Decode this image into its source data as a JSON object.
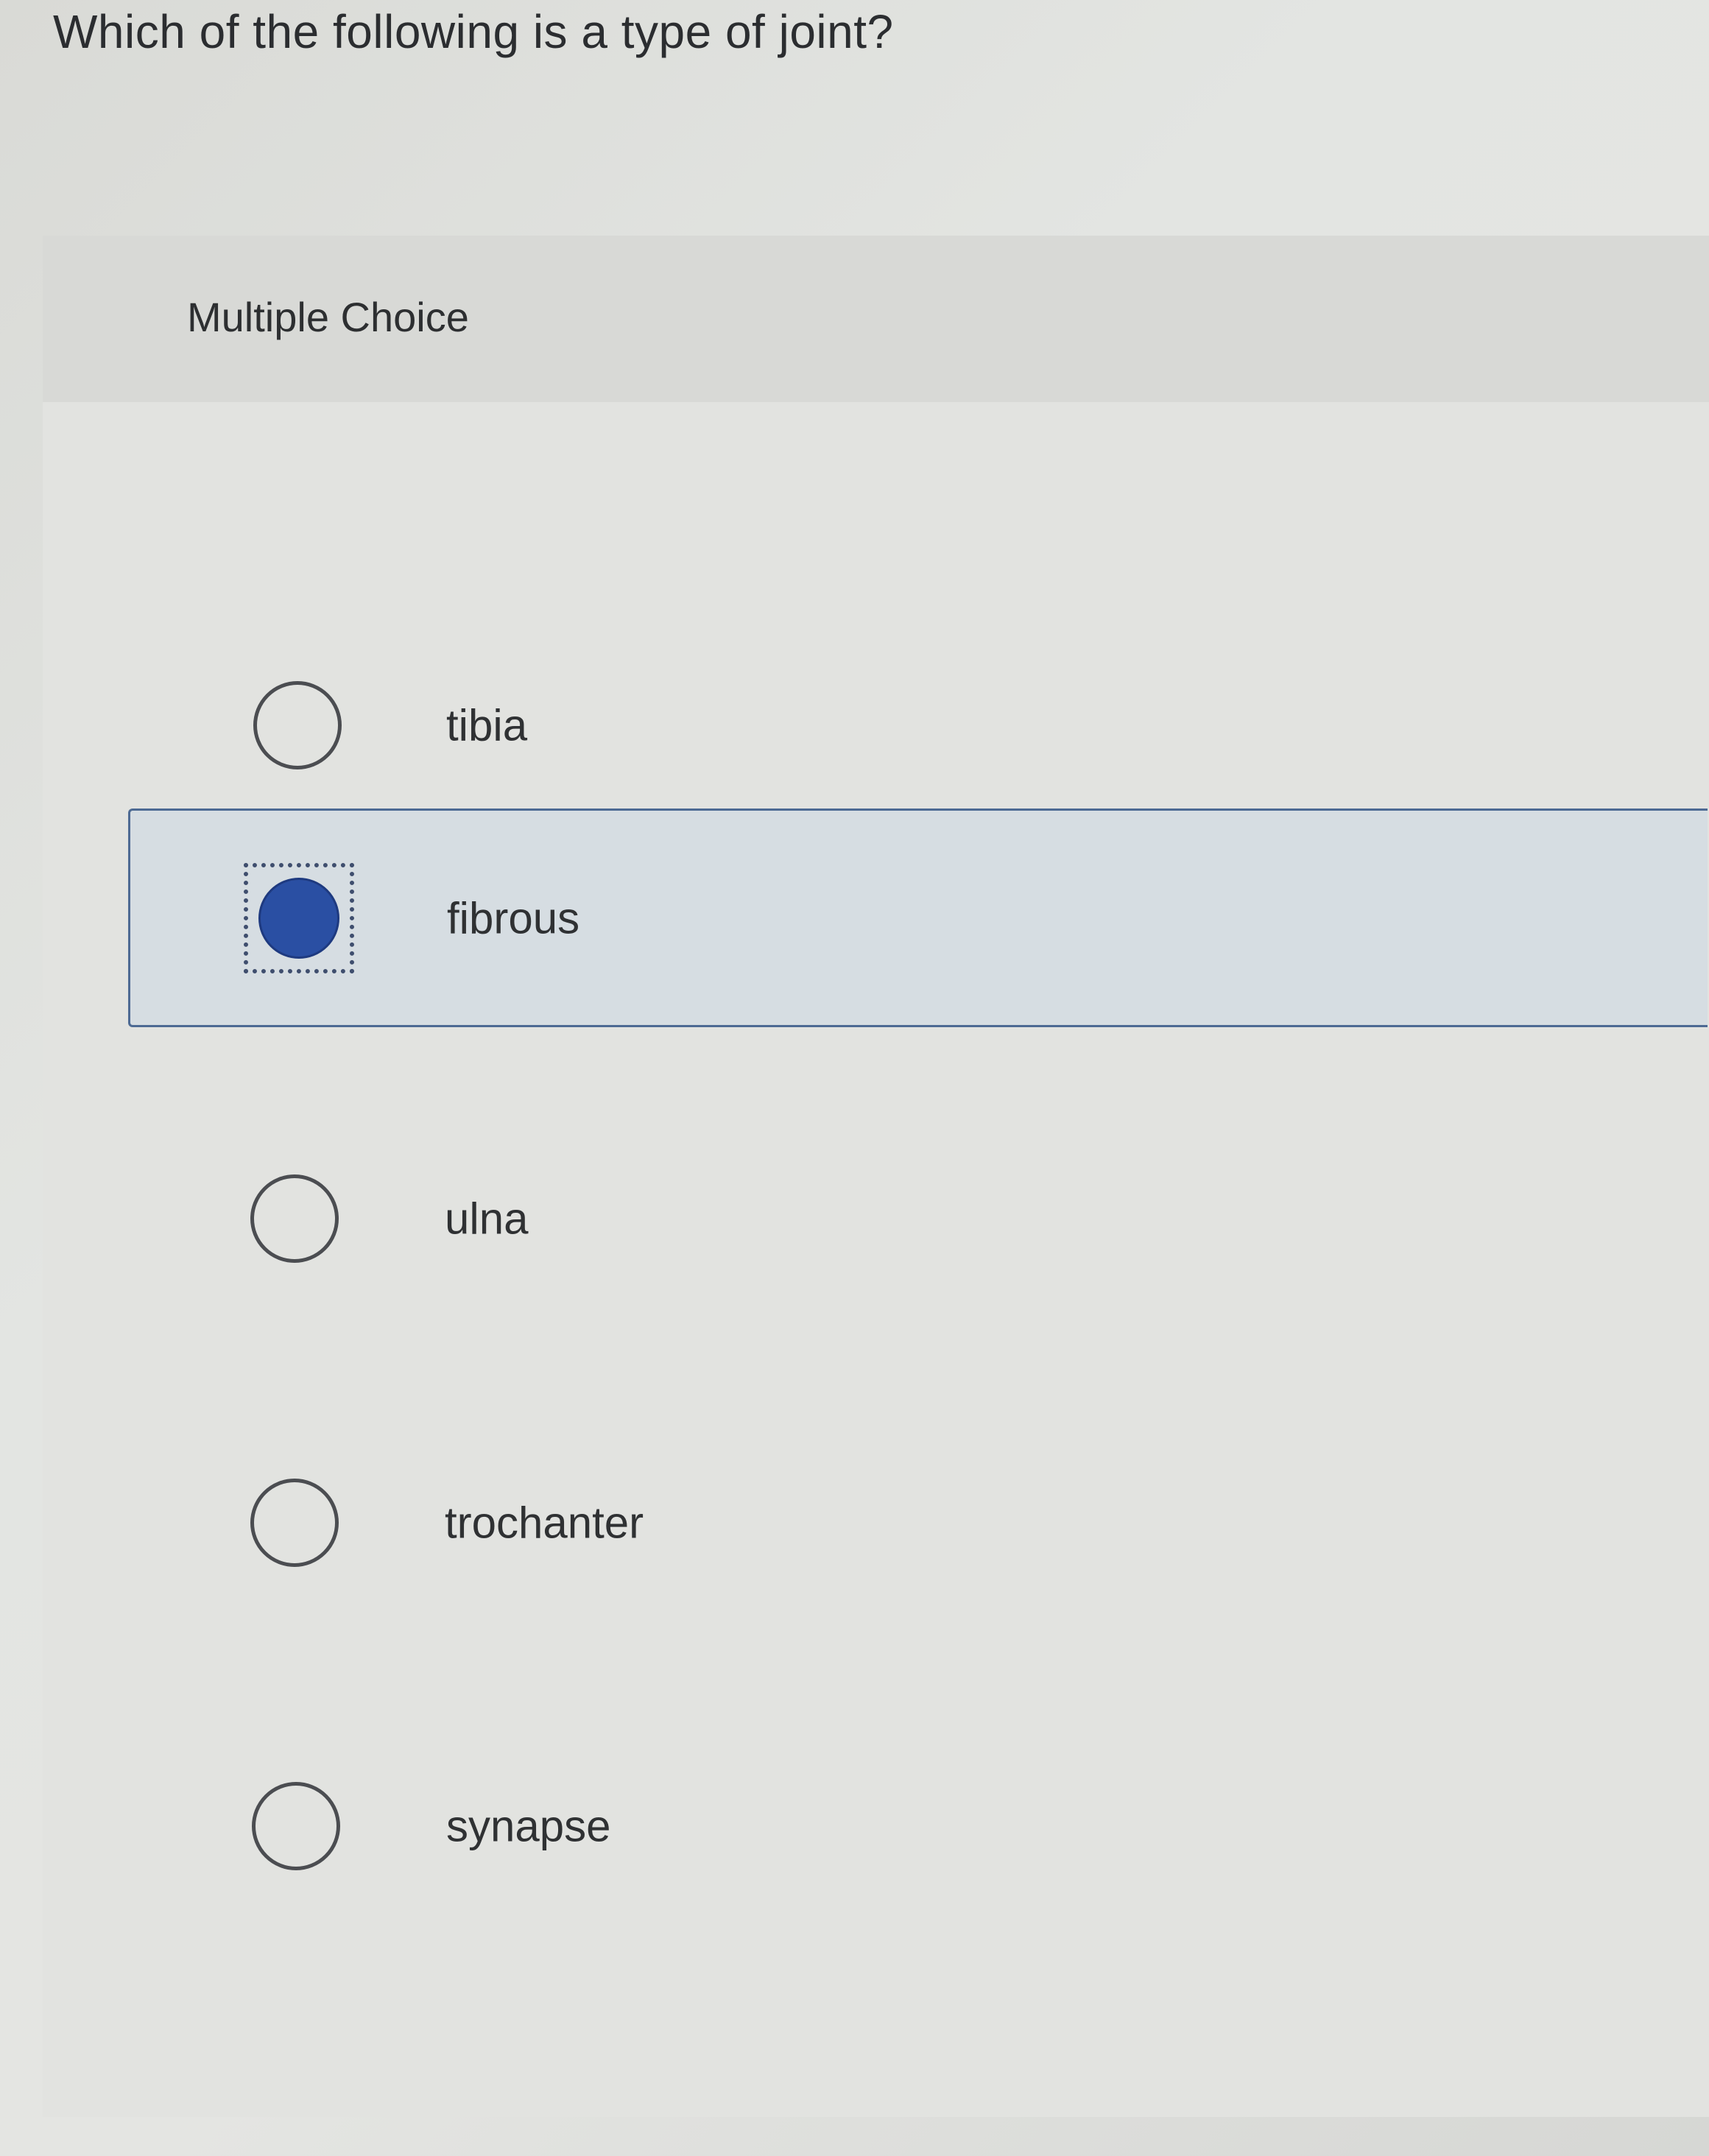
{
  "question": {
    "text": "Which of the following is a type of joint?"
  },
  "card": {
    "header_label": "Multiple Choice"
  },
  "options": [
    {
      "label": "tibia",
      "selected": false
    },
    {
      "label": "fibrous",
      "selected": true
    },
    {
      "label": "ulna",
      "selected": false
    },
    {
      "label": "trochanter",
      "selected": false
    },
    {
      "label": "synapse",
      "selected": false
    }
  ],
  "colors": {
    "accent": "#2a4fa3",
    "selected_border": "#4d6a93",
    "selected_background": "#d6dde2"
  },
  "icons": {
    "unselected": "radio-empty-icon",
    "selected": "radio-filled-icon"
  }
}
